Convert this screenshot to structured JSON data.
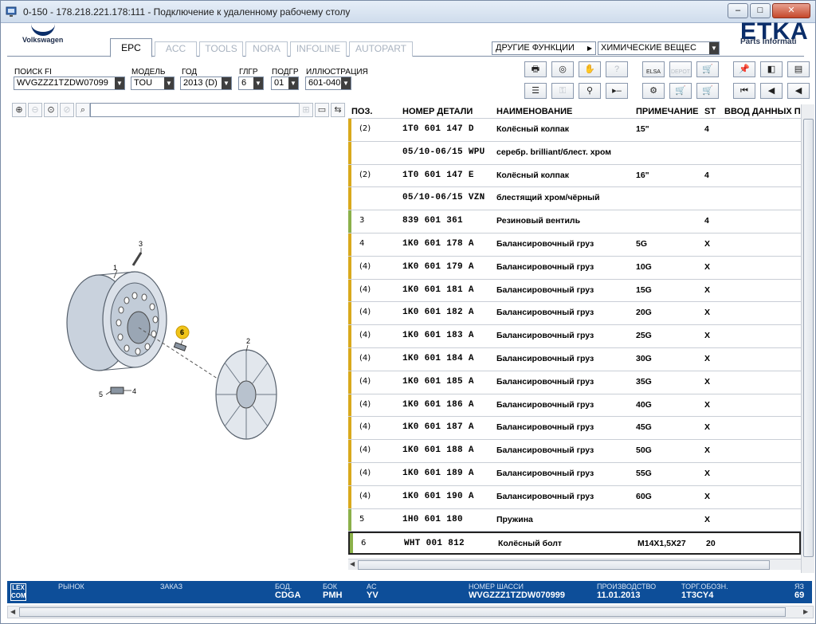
{
  "window": {
    "title": "0-150 - 178.218.221.178:111 - Подключение к удаленному рабочему столу",
    "buttons": {
      "min": "–",
      "max": "□",
      "close": "✕"
    }
  },
  "brand": {
    "vw": "Volkswagen",
    "etka": "ETKA",
    "etka_sub": "Parts Informati"
  },
  "tabs": [
    "EPC",
    "ACC",
    "TOOLS",
    "NORA",
    "INFOLINE",
    "AUTOPART"
  ],
  "active_tab": "EPC",
  "other_functions": {
    "label": "ДРУГИЕ ФУНКЦИИ",
    "arrow": "▶",
    "chemicals": "ХИМИЧЕСКИЕ ВЕЩЕС"
  },
  "search": {
    "fi_label": "ПОИСК FI",
    "fi_value": "WVGZZZ1TZDW07099",
    "model_label": "МОДЕЛЬ",
    "model_value": "TOU",
    "year_label": "ГОД",
    "year_value": "2013 (D)",
    "glgr_label": "ГЛГР",
    "glgr_value": "6",
    "podgr_label": "ПОДГР",
    "podgr_value": "01",
    "illus_label": "ИЛЛЮСТРАЦИЯ",
    "illus_value": "601-040"
  },
  "toolbar_icons": {
    "elsa": "ELSA",
    "depot": "DEPOT"
  },
  "table": {
    "headers": {
      "pos": "ПОЗ.",
      "part": "НОМЕР ДЕТАЛИ",
      "name": "НАИМЕНОВАНИЕ",
      "note": "ПРИМЕЧАНИЕ",
      "st": "ST",
      "input": "ВВОД ДАННЫХ ПО"
    },
    "rows": [
      {
        "pos": "(2)",
        "num": "1T0 601 147 D",
        "name": "Колёсный колпак",
        "note": "15\"",
        "st": "4",
        "bar": "#d9a91c"
      },
      {
        "pos": "",
        "num": "05/10-06/15 WPU",
        "name": "серебр. brilliant/блест. хром",
        "note": "",
        "st": "",
        "bar": "#d9a91c"
      },
      {
        "pos": "(2)",
        "num": "1T0 601 147 E",
        "name": "Колёсный колпак",
        "note": "16\"",
        "st": "4",
        "bar": "#d9a91c"
      },
      {
        "pos": "",
        "num": "05/10-06/15 VZN",
        "name": "блестящий хром/чёрный",
        "note": "",
        "st": "",
        "bar": "#d9a91c"
      },
      {
        "pos": "3",
        "num": "839 601 361",
        "name": "Резиновый вентиль",
        "note": "",
        "st": "4",
        "bar": "#8bb04a"
      },
      {
        "pos": "4",
        "num": "1K0 601 178 A",
        "name": "Балансировочный груз",
        "note": "5G",
        "st": "X",
        "bar": "#d9a91c"
      },
      {
        "pos": "(4)",
        "num": "1K0 601 179 A",
        "name": "Балансировочный груз",
        "note": "10G",
        "st": "X",
        "bar": "#d9a91c"
      },
      {
        "pos": "(4)",
        "num": "1K0 601 181 A",
        "name": "Балансировочный груз",
        "note": "15G",
        "st": "X",
        "bar": "#d9a91c"
      },
      {
        "pos": "(4)",
        "num": "1K0 601 182 A",
        "name": "Балансировочный груз",
        "note": "20G",
        "st": "X",
        "bar": "#d9a91c"
      },
      {
        "pos": "(4)",
        "num": "1K0 601 183 A",
        "name": "Балансировочный груз",
        "note": "25G",
        "st": "X",
        "bar": "#d9a91c"
      },
      {
        "pos": "(4)",
        "num": "1K0 601 184 A",
        "name": "Балансировочный груз",
        "note": "30G",
        "st": "X",
        "bar": "#d9a91c"
      },
      {
        "pos": "(4)",
        "num": "1K0 601 185 A",
        "name": "Балансировочный груз",
        "note": "35G",
        "st": "X",
        "bar": "#d9a91c"
      },
      {
        "pos": "(4)",
        "num": "1K0 601 186 A",
        "name": "Балансировочный груз",
        "note": "40G",
        "st": "X",
        "bar": "#d9a91c"
      },
      {
        "pos": "(4)",
        "num": "1K0 601 187 A",
        "name": "Балансировочный груз",
        "note": "45G",
        "st": "X",
        "bar": "#d9a91c"
      },
      {
        "pos": "(4)",
        "num": "1K0 601 188 A",
        "name": "Балансировочный груз",
        "note": "50G",
        "st": "X",
        "bar": "#d9a91c"
      },
      {
        "pos": "(4)",
        "num": "1K0 601 189 A",
        "name": "Балансировочный груз",
        "note": "55G",
        "st": "X",
        "bar": "#d9a91c"
      },
      {
        "pos": "(4)",
        "num": "1K0 601 190 A",
        "name": "Балансировочный груз",
        "note": "60G",
        "st": "X",
        "bar": "#d9a91c"
      },
      {
        "pos": "5",
        "num": "1H0 601 180",
        "name": "Пружина",
        "note": "",
        "st": "X",
        "bar": "#8bb04a"
      },
      {
        "pos": "6",
        "num": "WHT 001 812",
        "name": "Колёсный болт",
        "note": "M14X1,5X27",
        "st": "20",
        "bar": "#8bb04a"
      }
    ]
  },
  "illustration": {
    "callouts": [
      "1",
      "2",
      "3",
      "4",
      "5",
      "6"
    ],
    "highlight": "6"
  },
  "status": {
    "market_label": "РЫНОК",
    "order_label": "ЗАКАЗ",
    "bod_label": "БОД.",
    "bod_value": "CDGA",
    "bok_label": "БОК",
    "bok_value": "PMH",
    "ac_label": "AC",
    "ac_value": "YV",
    "chassis_label": "НОМЕР ШАССИ",
    "chassis_value": "WVGZZZ1TZDW070999",
    "prod_label": "ПРОИЗВОДСТВО",
    "prod_value": "11.01.2013",
    "torg_label": "ТОРГ.ОБОЗН.",
    "torg_value": "1T3CY4",
    "lang_label": "ЯЗ",
    "lang_value": "69",
    "lexcom": "LEX COM"
  },
  "colors": {
    "status_bg": "#0d4e99",
    "bar_yellow": "#d9a91c",
    "bar_green": "#8bb04a",
    "callout_highlight": "#f0c419"
  }
}
